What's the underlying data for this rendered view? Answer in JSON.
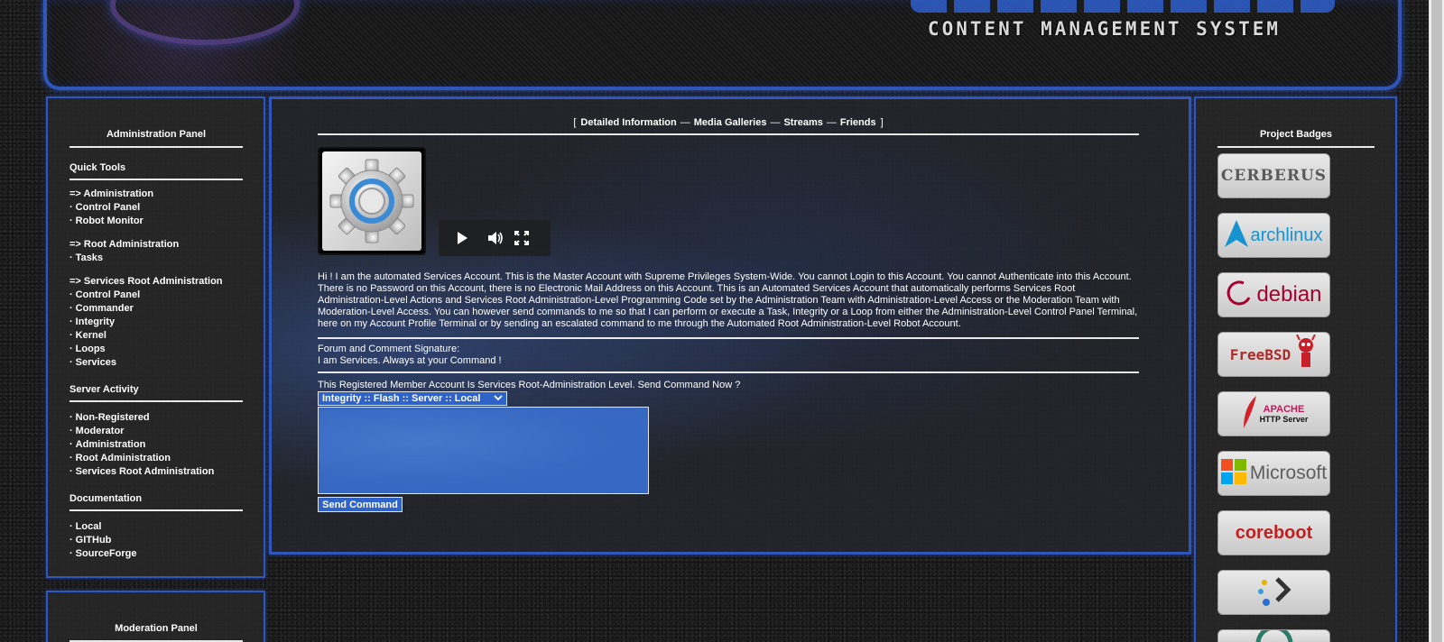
{
  "banner": {
    "subtitle": "CONTENT MANAGEMENT SYSTEM"
  },
  "left": {
    "title": "Administration Panel",
    "sections": [
      {
        "heading": "Quick Tools",
        "items": [
          {
            "label": "=> Administration",
            "arrow": true
          },
          {
            "label": "Control Panel"
          },
          {
            "label": "Robot Monitor"
          },
          {
            "label": "=> Root Administration",
            "arrow": true,
            "gap": true
          },
          {
            "label": "Tasks"
          },
          {
            "label": "=> Services Root Administration",
            "arrow": true,
            "gap": true
          },
          {
            "label": "Control Panel"
          },
          {
            "label": "Commander"
          },
          {
            "label": "Integrity"
          },
          {
            "label": "Kernel"
          },
          {
            "label": "Loops"
          },
          {
            "label": "Services"
          }
        ]
      },
      {
        "heading": "Server Activity",
        "items": [
          {
            "label": "Non-Registered"
          },
          {
            "label": "Moderator"
          },
          {
            "label": "Administration"
          },
          {
            "label": "Root Administration"
          },
          {
            "label": "Services Root Administration"
          }
        ]
      },
      {
        "heading": "Documentation",
        "items": [
          {
            "label": "Local"
          },
          {
            "label": "GITHub"
          },
          {
            "label": "SourceForge"
          }
        ]
      }
    ],
    "moderation_title": "Moderation Panel"
  },
  "center": {
    "tabs": [
      "Detailed Information",
      "Media Galleries",
      "Streams",
      "Friends"
    ],
    "bracket_open": "[",
    "bracket_close": "]",
    "separator": "—",
    "bio": "Hi ! I am the automated Services Account. This is the Master Account with Supreme Privileges System-Wide. You cannot Login to this Account. You cannot Authenticate into this Account. There is no Password on this Account, there is no Electronic Mail Address on this Account. This is an Automated Services Account that automatically performs Services Root Administration-Level Actions and Services Root Administration-Level Programming Code set by the Administration Team with Administration-Level Access or the Moderation Team with Moderation-Level Access. You can however send commands to me so that I can perform or execute a Task, Integrity or a Loop from either the Administration-Level Control Panel Terminal, here on my Account Profile Terminal or by sending an escalated command to me through the Automated Root Administration-Level Robot Account.",
    "signature_label": "Forum and Comment Signature:",
    "signature_text": "I am Services. Always at your Command !",
    "command_prompt": "This Registered Member Account Is Services Root-Administration Level. Send Command Now ?",
    "command_select_value": "Integrity :: Flash :: Server :: Local",
    "send_button": "Send Command"
  },
  "right": {
    "title": "Project Badges",
    "badges": [
      {
        "name": "cerberus",
        "label": "CERBERUS",
        "color": "#5a5a5a"
      },
      {
        "name": "archlinux",
        "label": "archlinux",
        "color": "#1793d1"
      },
      {
        "name": "debian",
        "label": "debian",
        "color": "#a80030"
      },
      {
        "name": "freebsd",
        "label": "FreeBSD",
        "color": "#ab2b28"
      },
      {
        "name": "apache",
        "label": "APACHE",
        "sublabel": "HTTP Server",
        "color": "#c2185b"
      },
      {
        "name": "microsoft",
        "label": "Microsoft",
        "color": "#5e5e5e"
      },
      {
        "name": "coreboot",
        "label": "coreboot",
        "color": "#c41e1e"
      },
      {
        "name": "prompt",
        "label": "",
        "color": "#333333"
      },
      {
        "name": "partial",
        "label": "",
        "color": "#2c7a6a"
      }
    ]
  },
  "colors": {
    "accent_border": "#2f56b8",
    "form_blue": "#2f63c8"
  }
}
